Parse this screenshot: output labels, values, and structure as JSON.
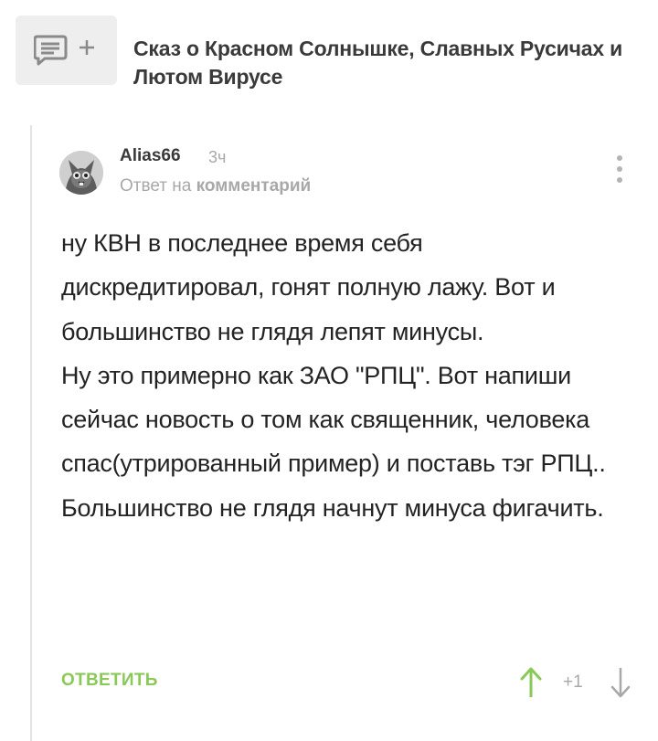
{
  "post": {
    "title": "Сказ о Красном Солнышке, Славных Русичах и Лютом Вирусе"
  },
  "comment": {
    "author": "Alias66",
    "time": "3ч",
    "reply_prefix": "Ответ на",
    "reply_target": "комментарий",
    "paragraphs": [
      "ну КВН в последнее время себя дискредитировал, гонят полную лажу. Вот и большинство не глядя лепят минусы.",
      "Ну это примерно как ЗАО \"РПЦ\". Вот напиши сейчас новость о том как священник,  человека спас(утрированный пример) и поставь тэг РПЦ.. Большинство не глядя начнут минуса фигачить."
    ],
    "reply_label": "ОТВЕТИТЬ",
    "rating": "+1"
  },
  "icons": {
    "add_comment": "comment-add-icon",
    "more": "more-vertical-icon",
    "vote_up": "arrow-up-icon",
    "vote_down": "arrow-down-icon"
  },
  "colors": {
    "accent_green": "#8ac858",
    "muted_gray": "#a8a8a8",
    "button_bg": "#eeeeee"
  }
}
